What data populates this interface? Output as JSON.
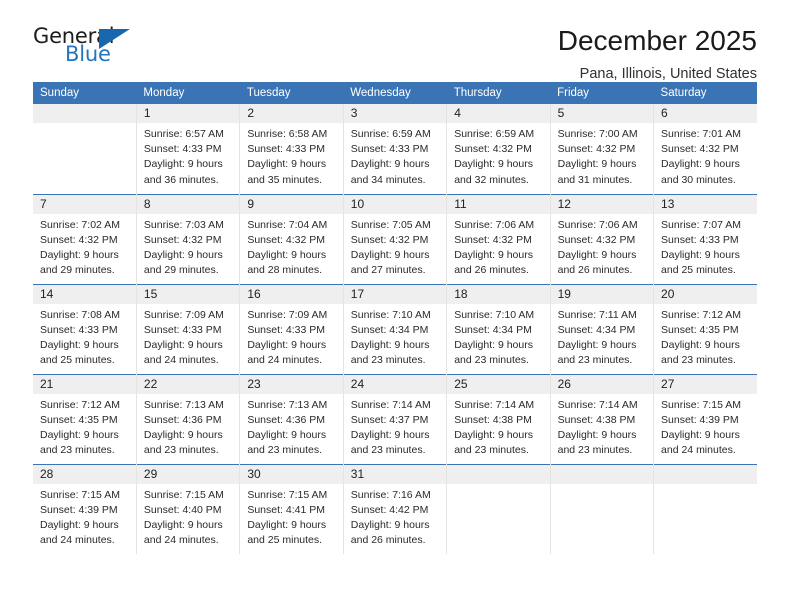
{
  "brand": {
    "name_top": "General",
    "name_bottom": "Blue",
    "triangle_color": "#1667ad",
    "blue_color": "#2276bd"
  },
  "header": {
    "title": "December 2025",
    "subtitle": "Pana, Illinois, United States"
  },
  "theme": {
    "header_row_bg": "#3a74b5",
    "daynum_band_bg": "#efefef",
    "cell_bg": "#ffffff",
    "row_separator": "#3a74b5",
    "text": "#222222"
  },
  "weekday_headers": [
    "Sunday",
    "Monday",
    "Tuesday",
    "Wednesday",
    "Thursday",
    "Friday",
    "Saturday"
  ],
  "labels": {
    "sunrise_prefix": "Sunrise:",
    "sunset_prefix": "Sunset:",
    "daylight_prefix": "Daylight:"
  },
  "chart_data": {
    "type": "table",
    "title": "December 2025",
    "subtitle": "Pana, Illinois, United States",
    "columns": [
      "Sunday",
      "Monday",
      "Tuesday",
      "Wednesday",
      "Thursday",
      "Friday",
      "Saturday"
    ],
    "fields": [
      "day",
      "sunrise",
      "sunset",
      "daylight"
    ],
    "weeks": [
      [
        {
          "day": "",
          "empty": true
        },
        {
          "day": "1",
          "sunrise": "Sunrise: 6:57 AM",
          "sunset": "Sunset: 4:33 PM",
          "daylight_line1": "Daylight: 9 hours",
          "daylight_line2": "and 36 minutes."
        },
        {
          "day": "2",
          "sunrise": "Sunrise: 6:58 AM",
          "sunset": "Sunset: 4:33 PM",
          "daylight_line1": "Daylight: 9 hours",
          "daylight_line2": "and 35 minutes."
        },
        {
          "day": "3",
          "sunrise": "Sunrise: 6:59 AM",
          "sunset": "Sunset: 4:33 PM",
          "daylight_line1": "Daylight: 9 hours",
          "daylight_line2": "and 34 minutes."
        },
        {
          "day": "4",
          "sunrise": "Sunrise: 6:59 AM",
          "sunset": "Sunset: 4:32 PM",
          "daylight_line1": "Daylight: 9 hours",
          "daylight_line2": "and 32 minutes."
        },
        {
          "day": "5",
          "sunrise": "Sunrise: 7:00 AM",
          "sunset": "Sunset: 4:32 PM",
          "daylight_line1": "Daylight: 9 hours",
          "daylight_line2": "and 31 minutes."
        },
        {
          "day": "6",
          "sunrise": "Sunrise: 7:01 AM",
          "sunset": "Sunset: 4:32 PM",
          "daylight_line1": "Daylight: 9 hours",
          "daylight_line2": "and 30 minutes."
        }
      ],
      [
        {
          "day": "7",
          "sunrise": "Sunrise: 7:02 AM",
          "sunset": "Sunset: 4:32 PM",
          "daylight_line1": "Daylight: 9 hours",
          "daylight_line2": "and 29 minutes."
        },
        {
          "day": "8",
          "sunrise": "Sunrise: 7:03 AM",
          "sunset": "Sunset: 4:32 PM",
          "daylight_line1": "Daylight: 9 hours",
          "daylight_line2": "and 29 minutes."
        },
        {
          "day": "9",
          "sunrise": "Sunrise: 7:04 AM",
          "sunset": "Sunset: 4:32 PM",
          "daylight_line1": "Daylight: 9 hours",
          "daylight_line2": "and 28 minutes."
        },
        {
          "day": "10",
          "sunrise": "Sunrise: 7:05 AM",
          "sunset": "Sunset: 4:32 PM",
          "daylight_line1": "Daylight: 9 hours",
          "daylight_line2": "and 27 minutes."
        },
        {
          "day": "11",
          "sunrise": "Sunrise: 7:06 AM",
          "sunset": "Sunset: 4:32 PM",
          "daylight_line1": "Daylight: 9 hours",
          "daylight_line2": "and 26 minutes."
        },
        {
          "day": "12",
          "sunrise": "Sunrise: 7:06 AM",
          "sunset": "Sunset: 4:32 PM",
          "daylight_line1": "Daylight: 9 hours",
          "daylight_line2": "and 26 minutes."
        },
        {
          "day": "13",
          "sunrise": "Sunrise: 7:07 AM",
          "sunset": "Sunset: 4:33 PM",
          "daylight_line1": "Daylight: 9 hours",
          "daylight_line2": "and 25 minutes."
        }
      ],
      [
        {
          "day": "14",
          "sunrise": "Sunrise: 7:08 AM",
          "sunset": "Sunset: 4:33 PM",
          "daylight_line1": "Daylight: 9 hours",
          "daylight_line2": "and 25 minutes."
        },
        {
          "day": "15",
          "sunrise": "Sunrise: 7:09 AM",
          "sunset": "Sunset: 4:33 PM",
          "daylight_line1": "Daylight: 9 hours",
          "daylight_line2": "and 24 minutes."
        },
        {
          "day": "16",
          "sunrise": "Sunrise: 7:09 AM",
          "sunset": "Sunset: 4:33 PM",
          "daylight_line1": "Daylight: 9 hours",
          "daylight_line2": "and 24 minutes."
        },
        {
          "day": "17",
          "sunrise": "Sunrise: 7:10 AM",
          "sunset": "Sunset: 4:34 PM",
          "daylight_line1": "Daylight: 9 hours",
          "daylight_line2": "and 23 minutes."
        },
        {
          "day": "18",
          "sunrise": "Sunrise: 7:10 AM",
          "sunset": "Sunset: 4:34 PM",
          "daylight_line1": "Daylight: 9 hours",
          "daylight_line2": "and 23 minutes."
        },
        {
          "day": "19",
          "sunrise": "Sunrise: 7:11 AM",
          "sunset": "Sunset: 4:34 PM",
          "daylight_line1": "Daylight: 9 hours",
          "daylight_line2": "and 23 minutes."
        },
        {
          "day": "20",
          "sunrise": "Sunrise: 7:12 AM",
          "sunset": "Sunset: 4:35 PM",
          "daylight_line1": "Daylight: 9 hours",
          "daylight_line2": "and 23 minutes."
        }
      ],
      [
        {
          "day": "21",
          "sunrise": "Sunrise: 7:12 AM",
          "sunset": "Sunset: 4:35 PM",
          "daylight_line1": "Daylight: 9 hours",
          "daylight_line2": "and 23 minutes."
        },
        {
          "day": "22",
          "sunrise": "Sunrise: 7:13 AM",
          "sunset": "Sunset: 4:36 PM",
          "daylight_line1": "Daylight: 9 hours",
          "daylight_line2": "and 23 minutes."
        },
        {
          "day": "23",
          "sunrise": "Sunrise: 7:13 AM",
          "sunset": "Sunset: 4:36 PM",
          "daylight_line1": "Daylight: 9 hours",
          "daylight_line2": "and 23 minutes."
        },
        {
          "day": "24",
          "sunrise": "Sunrise: 7:14 AM",
          "sunset": "Sunset: 4:37 PM",
          "daylight_line1": "Daylight: 9 hours",
          "daylight_line2": "and 23 minutes."
        },
        {
          "day": "25",
          "sunrise": "Sunrise: 7:14 AM",
          "sunset": "Sunset: 4:38 PM",
          "daylight_line1": "Daylight: 9 hours",
          "daylight_line2": "and 23 minutes."
        },
        {
          "day": "26",
          "sunrise": "Sunrise: 7:14 AM",
          "sunset": "Sunset: 4:38 PM",
          "daylight_line1": "Daylight: 9 hours",
          "daylight_line2": "and 23 minutes."
        },
        {
          "day": "27",
          "sunrise": "Sunrise: 7:15 AM",
          "sunset": "Sunset: 4:39 PM",
          "daylight_line1": "Daylight: 9 hours",
          "daylight_line2": "and 24 minutes."
        }
      ],
      [
        {
          "day": "28",
          "sunrise": "Sunrise: 7:15 AM",
          "sunset": "Sunset: 4:39 PM",
          "daylight_line1": "Daylight: 9 hours",
          "daylight_line2": "and 24 minutes."
        },
        {
          "day": "29",
          "sunrise": "Sunrise: 7:15 AM",
          "sunset": "Sunset: 4:40 PM",
          "daylight_line1": "Daylight: 9 hours",
          "daylight_line2": "and 24 minutes."
        },
        {
          "day": "30",
          "sunrise": "Sunrise: 7:15 AM",
          "sunset": "Sunset: 4:41 PM",
          "daylight_line1": "Daylight: 9 hours",
          "daylight_line2": "and 25 minutes."
        },
        {
          "day": "31",
          "sunrise": "Sunrise: 7:16 AM",
          "sunset": "Sunset: 4:42 PM",
          "daylight_line1": "Daylight: 9 hours",
          "daylight_line2": "and 26 minutes."
        },
        {
          "day": "",
          "empty": true
        },
        {
          "day": "",
          "empty": true
        },
        {
          "day": "",
          "empty": true
        }
      ]
    ]
  }
}
